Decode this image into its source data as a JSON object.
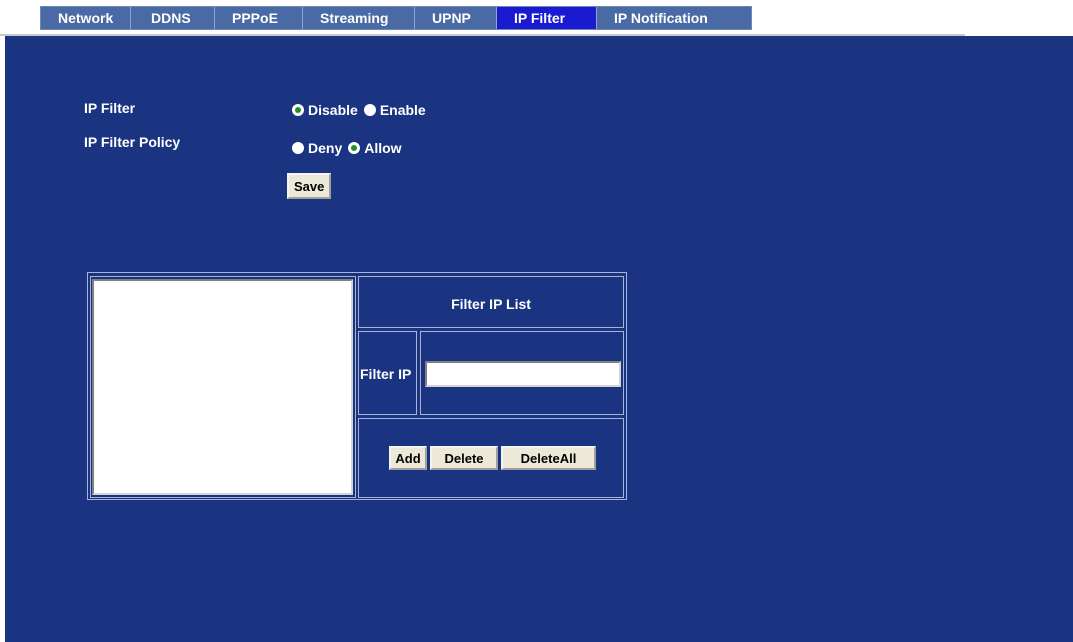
{
  "tabs": [
    {
      "label": "Network",
      "active": false
    },
    {
      "label": "DDNS",
      "active": false
    },
    {
      "label": "PPPoE",
      "active": false
    },
    {
      "label": "Streaming",
      "active": false
    },
    {
      "label": "UPNP",
      "active": false
    },
    {
      "label": "IP Filter",
      "active": true
    },
    {
      "label": "IP Notification",
      "active": false
    }
  ],
  "form": {
    "ip_filter_label": "IP Filter",
    "ip_filter_options": [
      {
        "label": "Disable",
        "checked": true
      },
      {
        "label": "Enable",
        "checked": false
      }
    ],
    "policy_label": "IP Filter Policy",
    "policy_options": [
      {
        "label": "Deny",
        "checked": false
      },
      {
        "label": "Allow",
        "checked": true
      }
    ],
    "save_label": "Save"
  },
  "filter_list": {
    "title": "Filter IP List",
    "filter_ip_label": "Filter IP",
    "filter_ip_value": "",
    "entries": [],
    "add_label": "Add",
    "delete_label": "Delete",
    "delete_all_label": "DeleteAll"
  },
  "colors": {
    "panel_background": "#1a3482",
    "tab_background": "#4a6aa5",
    "tab_active_background": "#1a1ad0",
    "radio_checked_dot": "#2a8c2a"
  }
}
